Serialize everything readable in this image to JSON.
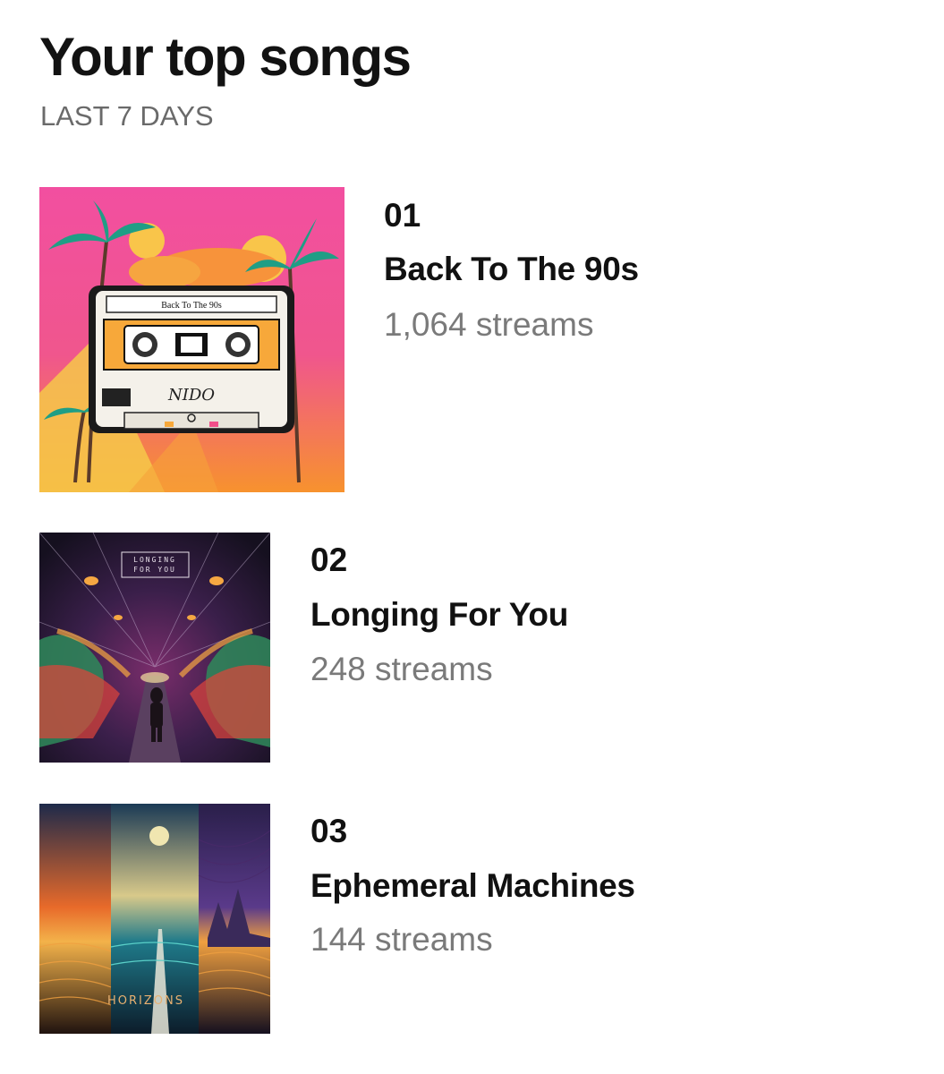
{
  "header": {
    "title": "Your top songs",
    "subtitle": "LAST 7 DAYS"
  },
  "songs": [
    {
      "rank": "01",
      "title": "Back To The 90s",
      "streams": "1,064 streams",
      "art_label": "Back To The 90s",
      "art_signature": "NIDO",
      "art_colors": {
        "bg_top": "#f24fa0",
        "bg_bottom": "#f7922e",
        "sun": "#f9c54a",
        "palm": "#1f9e85"
      }
    },
    {
      "rank": "02",
      "title": "Longing For You",
      "streams": "248 streams",
      "art_label_line1": "LONGING",
      "art_label_line2": "FOR YOU",
      "art_colors": {
        "bg_top": "#1d1530",
        "bg_mid": "#7a2d6b",
        "glow": "#f5a742"
      }
    },
    {
      "rank": "03",
      "title": "Ephemeral Machines",
      "streams": "144 streams",
      "art_label": "HORIZONS",
      "art_colors": {
        "left": "#e86a2a",
        "center": "#1f7a8a",
        "right": "#5a3a8a"
      }
    }
  ]
}
